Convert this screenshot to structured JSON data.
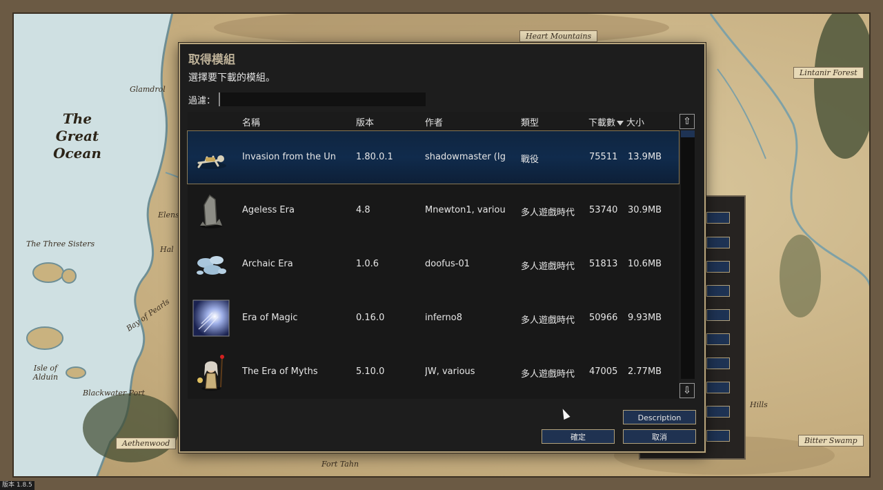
{
  "map": {
    "ocean_title": "The Great Ocean",
    "labels": {
      "glamdrol": "Glamdrol",
      "elens": "Elens",
      "hal": "Hal",
      "three_sisters": "The Three Sisters",
      "bay_of_pearls": "Bay of Pearls",
      "isle_of_alduin": "Isle of Alduin",
      "blackwater_port": "Blackwater Port",
      "fort_tahn": "Fort Tahn",
      "hills": "Hills"
    },
    "plaques": {
      "heart_mountains": "Heart Mountains",
      "lintanir_forest": "Lintanir Forest",
      "aethenwood": "Aethenwood",
      "bitter_swamp": "Bitter Swamp"
    }
  },
  "version_tag": "版本 1.8.5",
  "dialog": {
    "title": "取得模組",
    "subtitle": "選擇要下載的模組。",
    "filter_label": "過濾：",
    "filter_value": "",
    "columns": {
      "name": "名稱",
      "version": "版本",
      "author": "作者",
      "type": "類型",
      "downloads": "下載數",
      "size": "大小"
    },
    "rows": [
      {
        "name": "Invasion from the Un",
        "version": "1.80.0.1",
        "author": "shadowmaster (Ig",
        "type": "戰役",
        "downloads": "75511",
        "size": "13.9MB",
        "icon": "skeleton-icon"
      },
      {
        "name": "Ageless Era",
        "version": "4.8",
        "author": "Mnewton1, variou",
        "type": "多人遊戲時代",
        "downloads": "53740",
        "size": "30.9MB",
        "icon": "stone-icon"
      },
      {
        "name": "Archaic Era",
        "version": "1.0.6",
        "author": "doofus-01",
        "type": "多人遊戲時代",
        "downloads": "51813",
        "size": "10.6MB",
        "icon": "cloud-icon"
      },
      {
        "name": "Era of Magic",
        "version": "0.16.0",
        "author": "inferno8",
        "type": "多人遊戲時代",
        "downloads": "50966",
        "size": "9.93MB",
        "icon": "magic-burst-icon"
      },
      {
        "name": "The Era of Myths",
        "version": "5.10.0",
        "author": "JW, various",
        "type": "多人遊戲時代",
        "downloads": "47005",
        "size": "2.77MB",
        "icon": "mage-icon"
      }
    ],
    "buttons": {
      "description": "Description",
      "ok": "確定",
      "cancel": "取消"
    }
  },
  "colors": {
    "dialog_bg": "#1d1d1d",
    "border_gold": "#b8a57d",
    "button_blue": "#1f3251",
    "selected_row": "#102b4c"
  }
}
